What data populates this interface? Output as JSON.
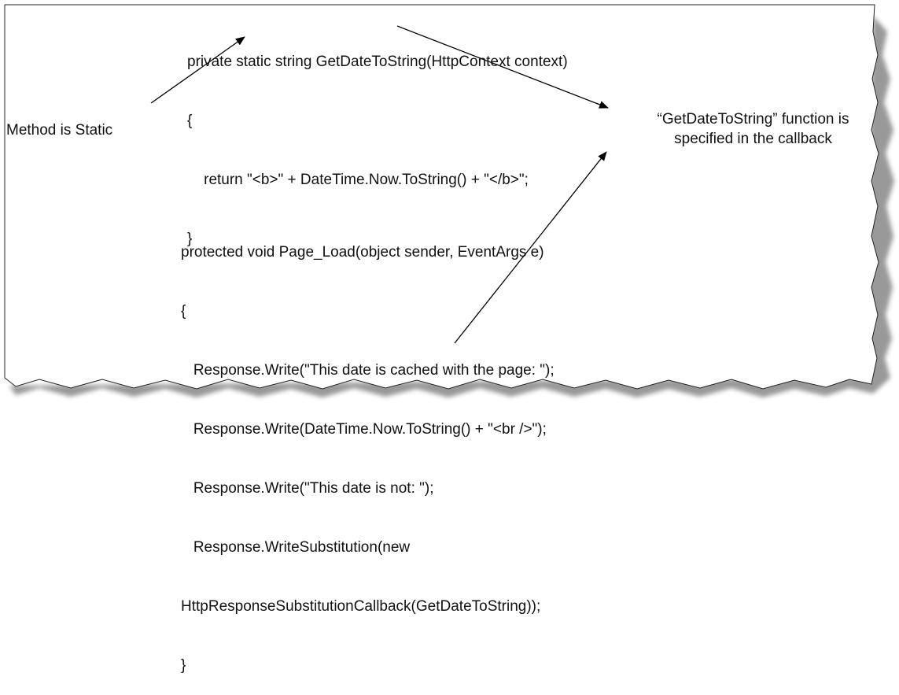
{
  "code_top": [
    "private static string GetDateToString(HttpContext context)",
    "{",
    "    return \"<b>\" + DateTime.Now.ToString() + \"</b>\";",
    "}"
  ],
  "code_bottom": [
    "protected void Page_Load(object sender, EventArgs e)",
    "{",
    "   Response.Write(\"This date is cached with the page: \");",
    "   Response.Write(DateTime.Now.ToString() + \"<br />\");",
    "   Response.Write(\"This date is not: \");",
    "   Response.WriteSubstitution(new",
    "HttpResponseSubstitutionCallback(GetDateToString));",
    "}"
  ],
  "annotations": {
    "left": "Method is Static",
    "right_line1": "“GetDateToString” function is",
    "right_line2": "specified in the callback"
  }
}
